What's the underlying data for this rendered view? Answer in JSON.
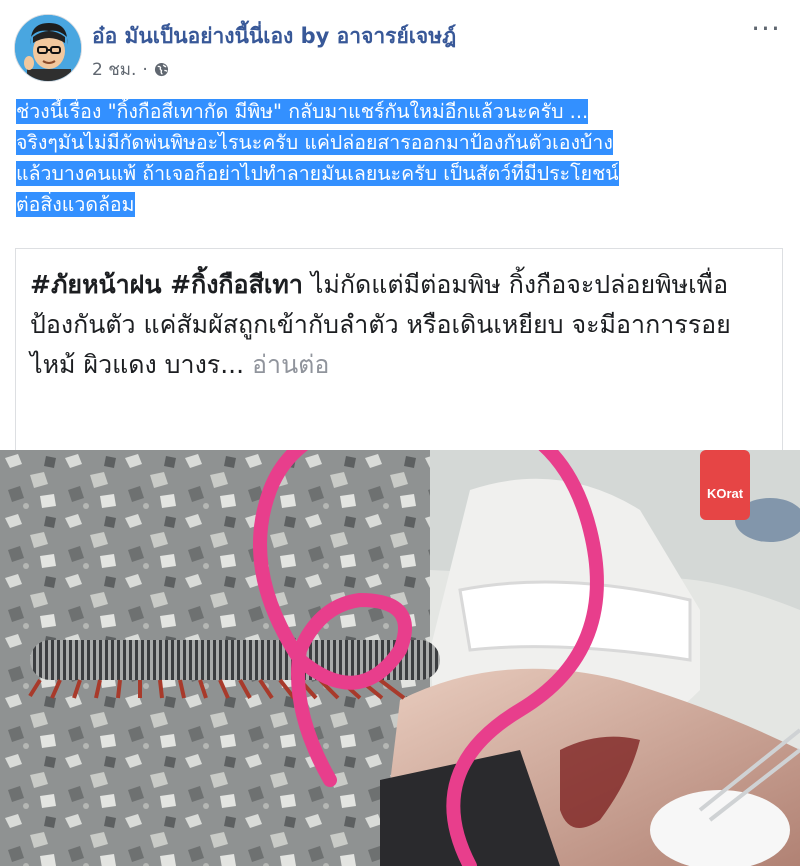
{
  "post": {
    "author": "อ๋อ มันเป็นอย่างนี้นี่เอง by อาจารย์เจษฎ์",
    "time": "2 ชม.",
    "separator": "·",
    "more_label": "···",
    "text": "ช่วงนี้เรื่อง \"กิ้งกือสีเทากัด มีพิษ\" กลับมาแชร์กันใหม่อีกแล้วนะครับ ...\nจริงๆมันไม่มีกัดพ่นพิษอะไรนะครับ แค่ปล่อยสารออกมาป้องกันตัวเองบ้าง\nแล้วบางคนแพ้ ถ้าเจอก็อย่าไปทำลายมันเลยนะครับ เป็นสัตว์ที่มีประโยชน์\nต่อสิ่งแวดล้อม"
  },
  "shared": {
    "hashtags": "#ภัยหน้าฝน #กิ้งกือสีเทา",
    "body": " ไม่กัดแต่มีต่อมพิษ กิ้งกือจะปล่อยพิษเพื่อป้องกันตัว แค่สัมผัสถูกเข้ากับลำตัว หรือเดินเหยียบ จะมีอาการรอยไหม้ ผิวแดง บางร...",
    "read_more": "อ่านต่อ",
    "watermark": "KOrat"
  },
  "colors": {
    "link": "#385898",
    "highlight": "#3390ff",
    "circle": "#e83e8c"
  },
  "icons": {
    "privacy": "globe-icon",
    "more": "ellipsis-icon"
  }
}
